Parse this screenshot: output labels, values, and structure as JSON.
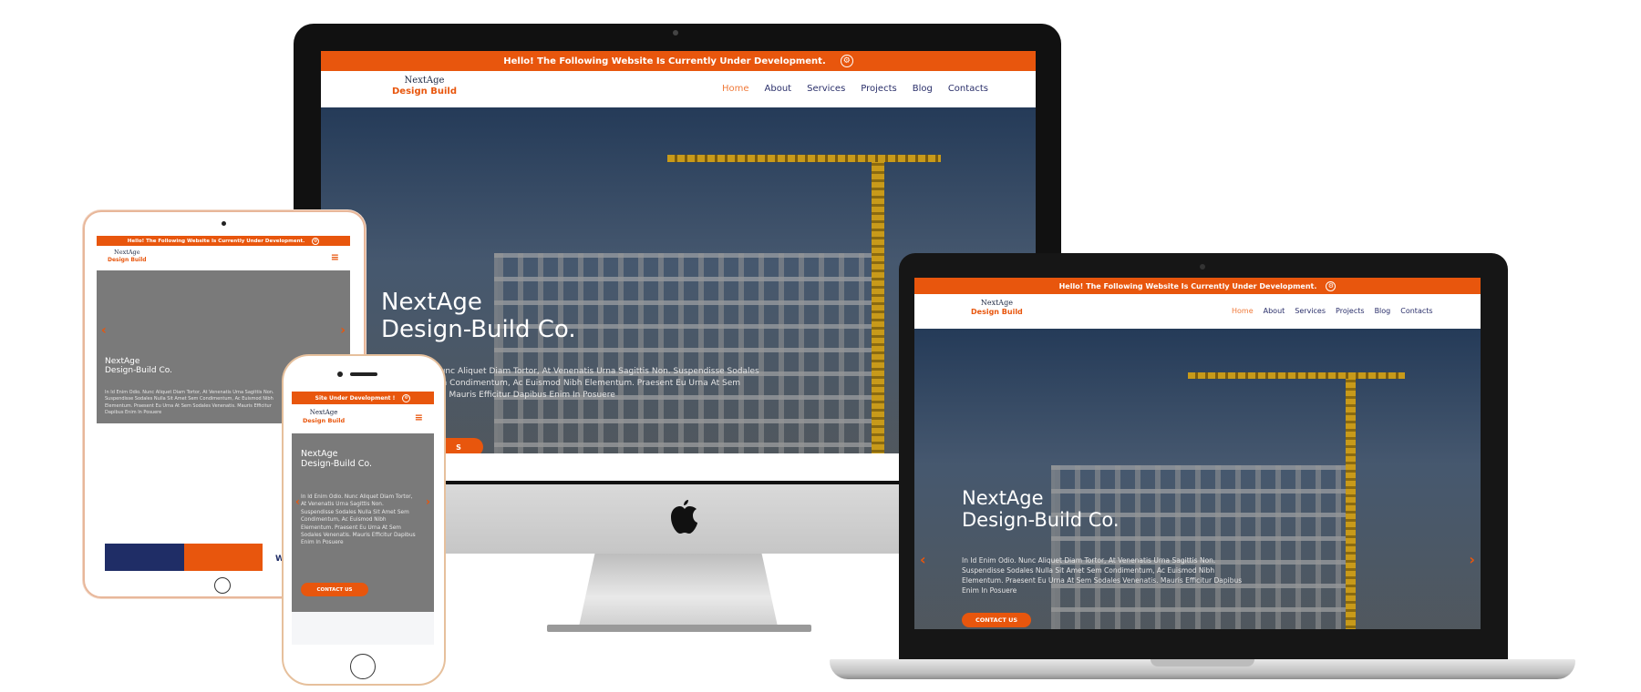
{
  "notice": {
    "long": "Hello! The Following Website Is Currently Under Development.",
    "short": "Site Under Development !"
  },
  "logo": {
    "name": "NextAge",
    "sub": "Design Build"
  },
  "nav": [
    "Home",
    "About",
    "Services",
    "Projects",
    "Blog",
    "Contacts"
  ],
  "hero": {
    "title_line1": "NextAge",
    "title_line2": "Design-Build Co.",
    "text": "In Id Enim Odio. Nunc Aliquet Diam Tortor, At Venenatis Urna Sagittis Non. Suspendisse Sodales Nulla Sit Amet Sem Condimentum, Ac Euismod Nibh Elementum. Praesent Eu Urna At Sem Sodales Venenatis. Mauris Efficitur Dapibus Enim In Posuere",
    "imac_text_visible": "Nunc Aliquet Diam Tortor, At Venenatis Urna Sagittis Non. Suspendisse Sodales\nem Condimentum, Ac Euismod Nibh Elementum. Praesent Eu Urna At Sem\ntis. Mauris Efficitur Dapibus Enim In Posuere",
    "cta": "CONTACT US",
    "cta_imac_visible": "S"
  },
  "tablet_footer": {
    "partial_text": "W"
  },
  "icons": {
    "gear": "gear-icon",
    "hamburger": "hamburger-menu-icon",
    "prev": "chevron-left-icon",
    "next": "chevron-right-icon",
    "apple": "apple-logo-icon"
  },
  "colors": {
    "accent": "#e8560d",
    "nav_text": "#2a2f6a",
    "active": "#f07a3a"
  }
}
